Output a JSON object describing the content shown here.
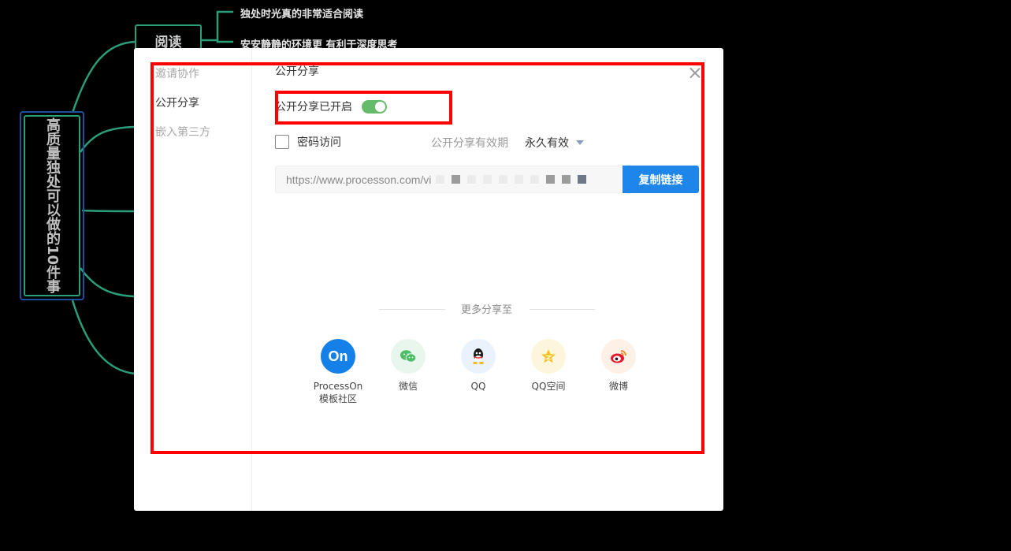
{
  "mindmap": {
    "root_text": "高质量独处可以做的10件事",
    "topic": "阅读",
    "leaves": [
      "独处时光真的非常适合阅读",
      "安安静静的环境更 有利于深度思考"
    ]
  },
  "dialog": {
    "sidebar": {
      "items": [
        {
          "label": "邀请协作"
        },
        {
          "label": "公开分享"
        },
        {
          "label": "嵌入第三方"
        }
      ]
    },
    "section_title": "公开分享",
    "toggle": {
      "label": "公开分享已开启",
      "on": true
    },
    "password": {
      "label": "密码访问",
      "checked": false
    },
    "expiry": {
      "label": "公开分享有效期",
      "value": "永久有效"
    },
    "link": {
      "url": "https://www.processon.com/vi",
      "copy_label": "复制链接"
    },
    "more_share": {
      "title": "更多分享至",
      "targets": [
        {
          "line1": "ProcessOn",
          "line2": "模板社区",
          "icon": "processon-icon",
          "color": "#1580e8"
        },
        {
          "line1": "微信",
          "line2": "",
          "icon": "wechat-icon",
          "color": "#4cbf67"
        },
        {
          "line1": "QQ",
          "line2": "",
          "icon": "qq-icon",
          "color": "#1a1a1a"
        },
        {
          "line1": "QQ空间",
          "line2": "",
          "icon": "qzone-icon",
          "color": "#f4c21c"
        },
        {
          "line1": "微博",
          "line2": "",
          "icon": "weibo-icon",
          "color": "#e6162d"
        }
      ]
    }
  },
  "colors": {
    "accent": "#1e86e8",
    "toggle_on": "#66bb6a",
    "highlight": "#ff0000",
    "mindmap_line": "#2a9d7a"
  }
}
